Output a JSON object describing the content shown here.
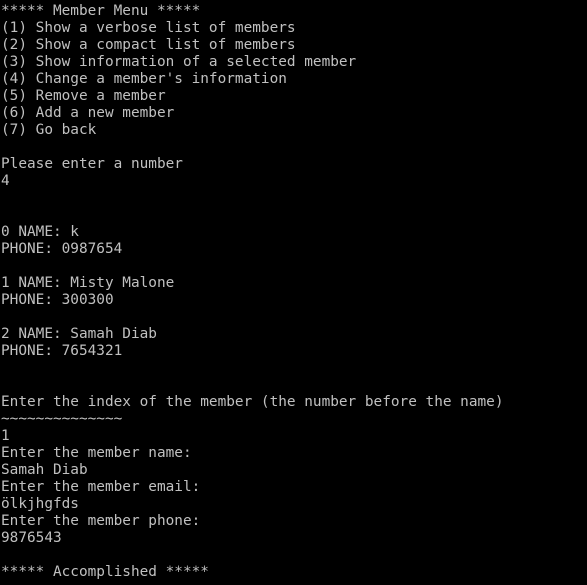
{
  "terminal": {
    "background_color": "#000000",
    "text_color": "#c0c0c0",
    "menu": {
      "title": "***** Member Menu *****",
      "options": [
        "(1) Show a verbose list of members",
        "(2) Show a compact list of members",
        "(3) Show information of a selected member",
        "(4) Change a member's information",
        "(5) Remove a member",
        "(6) Add a new member",
        "(7) Go back"
      ]
    },
    "prompt_number": "Please enter a number",
    "entered_number": "4",
    "members": [
      {
        "name_line": "0 NAME: k",
        "phone_line": "PHONE: 0987654"
      },
      {
        "name_line": "1 NAME: Misty Malone",
        "phone_line": "PHONE: 300300"
      },
      {
        "name_line": "2 NAME: Samah Diab",
        "phone_line": "PHONE: 7654321"
      }
    ],
    "prompt_index": "Enter the index of the member (the number before the name)",
    "underline": "~~~~~~~~~~~~~~",
    "entered_index": "1",
    "prompt_name": "Enter the member name:",
    "entered_name": "Samah Diab",
    "prompt_email": "Enter the member email:",
    "entered_email": "ölkjhgfds",
    "prompt_phone": "Enter the member phone:",
    "entered_phone": "9876543",
    "result": "***** Accomplished *****"
  }
}
